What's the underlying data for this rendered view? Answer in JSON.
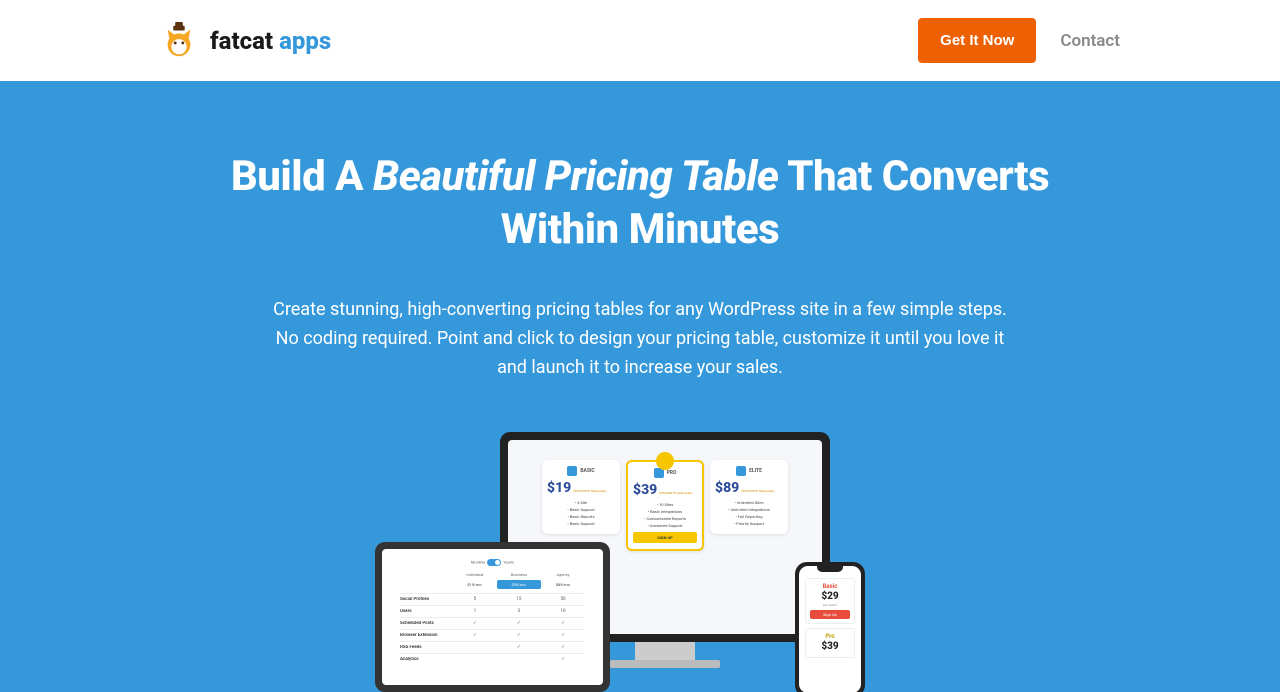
{
  "brand": {
    "name1": "fatcat",
    "name2": " apps"
  },
  "nav": {
    "cta": "Get It Now",
    "contact": "Contact"
  },
  "hero": {
    "h1_a": "Build A ",
    "h1_b": "Beautiful Pricing Table",
    "h1_c": " That Converts Within Minutes",
    "sub": "Create stunning, high-converting pricing tables for any WordPress site in a few simple steps. No coding required. Point and click to design your pricing table, customize it until you love it and launch it to increase your sales."
  },
  "monitor": {
    "plans": [
      {
        "name": "BASIC",
        "price": "$19",
        "sub": "PER MONTH billed yearly",
        "features": [
          "3 Site",
          "Basic Support",
          "Basic Reports",
          "Basic Support"
        ]
      },
      {
        "name": "PRO",
        "price": "$39",
        "sub": "PER MONTH billed yearly",
        "features": [
          "10 Sites",
          "Basic Integrations",
          "Customizable Reports",
          "Advanced Support"
        ],
        "btn": "SIGN UP"
      },
      {
        "name": "ELITE",
        "price": "$89",
        "sub": "PER MONTH billed yearly",
        "features": [
          "Unlimited Sites",
          "Unlimited Integrations",
          "Full Reporting",
          "Priority Support"
        ]
      }
    ]
  },
  "tablet": {
    "toggle_left": "Monthly",
    "toggle_right": "Yearly",
    "cols": [
      "",
      "Individual",
      "Business",
      "Agency"
    ],
    "colsub": [
      "",
      "$19/mo",
      "$39/mo",
      "$89/mo"
    ],
    "rows": [
      {
        "label": "Social Profiles",
        "v": [
          "5",
          "15",
          "50"
        ]
      },
      {
        "label": "Users",
        "v": [
          "1",
          "3",
          "10"
        ]
      },
      {
        "label": "Scheduled Posts",
        "v": [
          "✓",
          "✓",
          "✓"
        ]
      },
      {
        "label": "Browser Extension",
        "v": [
          "✓",
          "✓",
          "✓"
        ]
      },
      {
        "label": "RSS Feeds",
        "v": [
          "",
          "✓",
          "✓"
        ]
      },
      {
        "label": "Analytics",
        "v": [
          "",
          "",
          "✓"
        ]
      }
    ]
  },
  "phone": {
    "p1": {
      "name": "Basic",
      "price": "$29",
      "sub": "per month",
      "btn": "Sign Up"
    },
    "p2": {
      "name": "Pro",
      "price": "$39"
    }
  }
}
